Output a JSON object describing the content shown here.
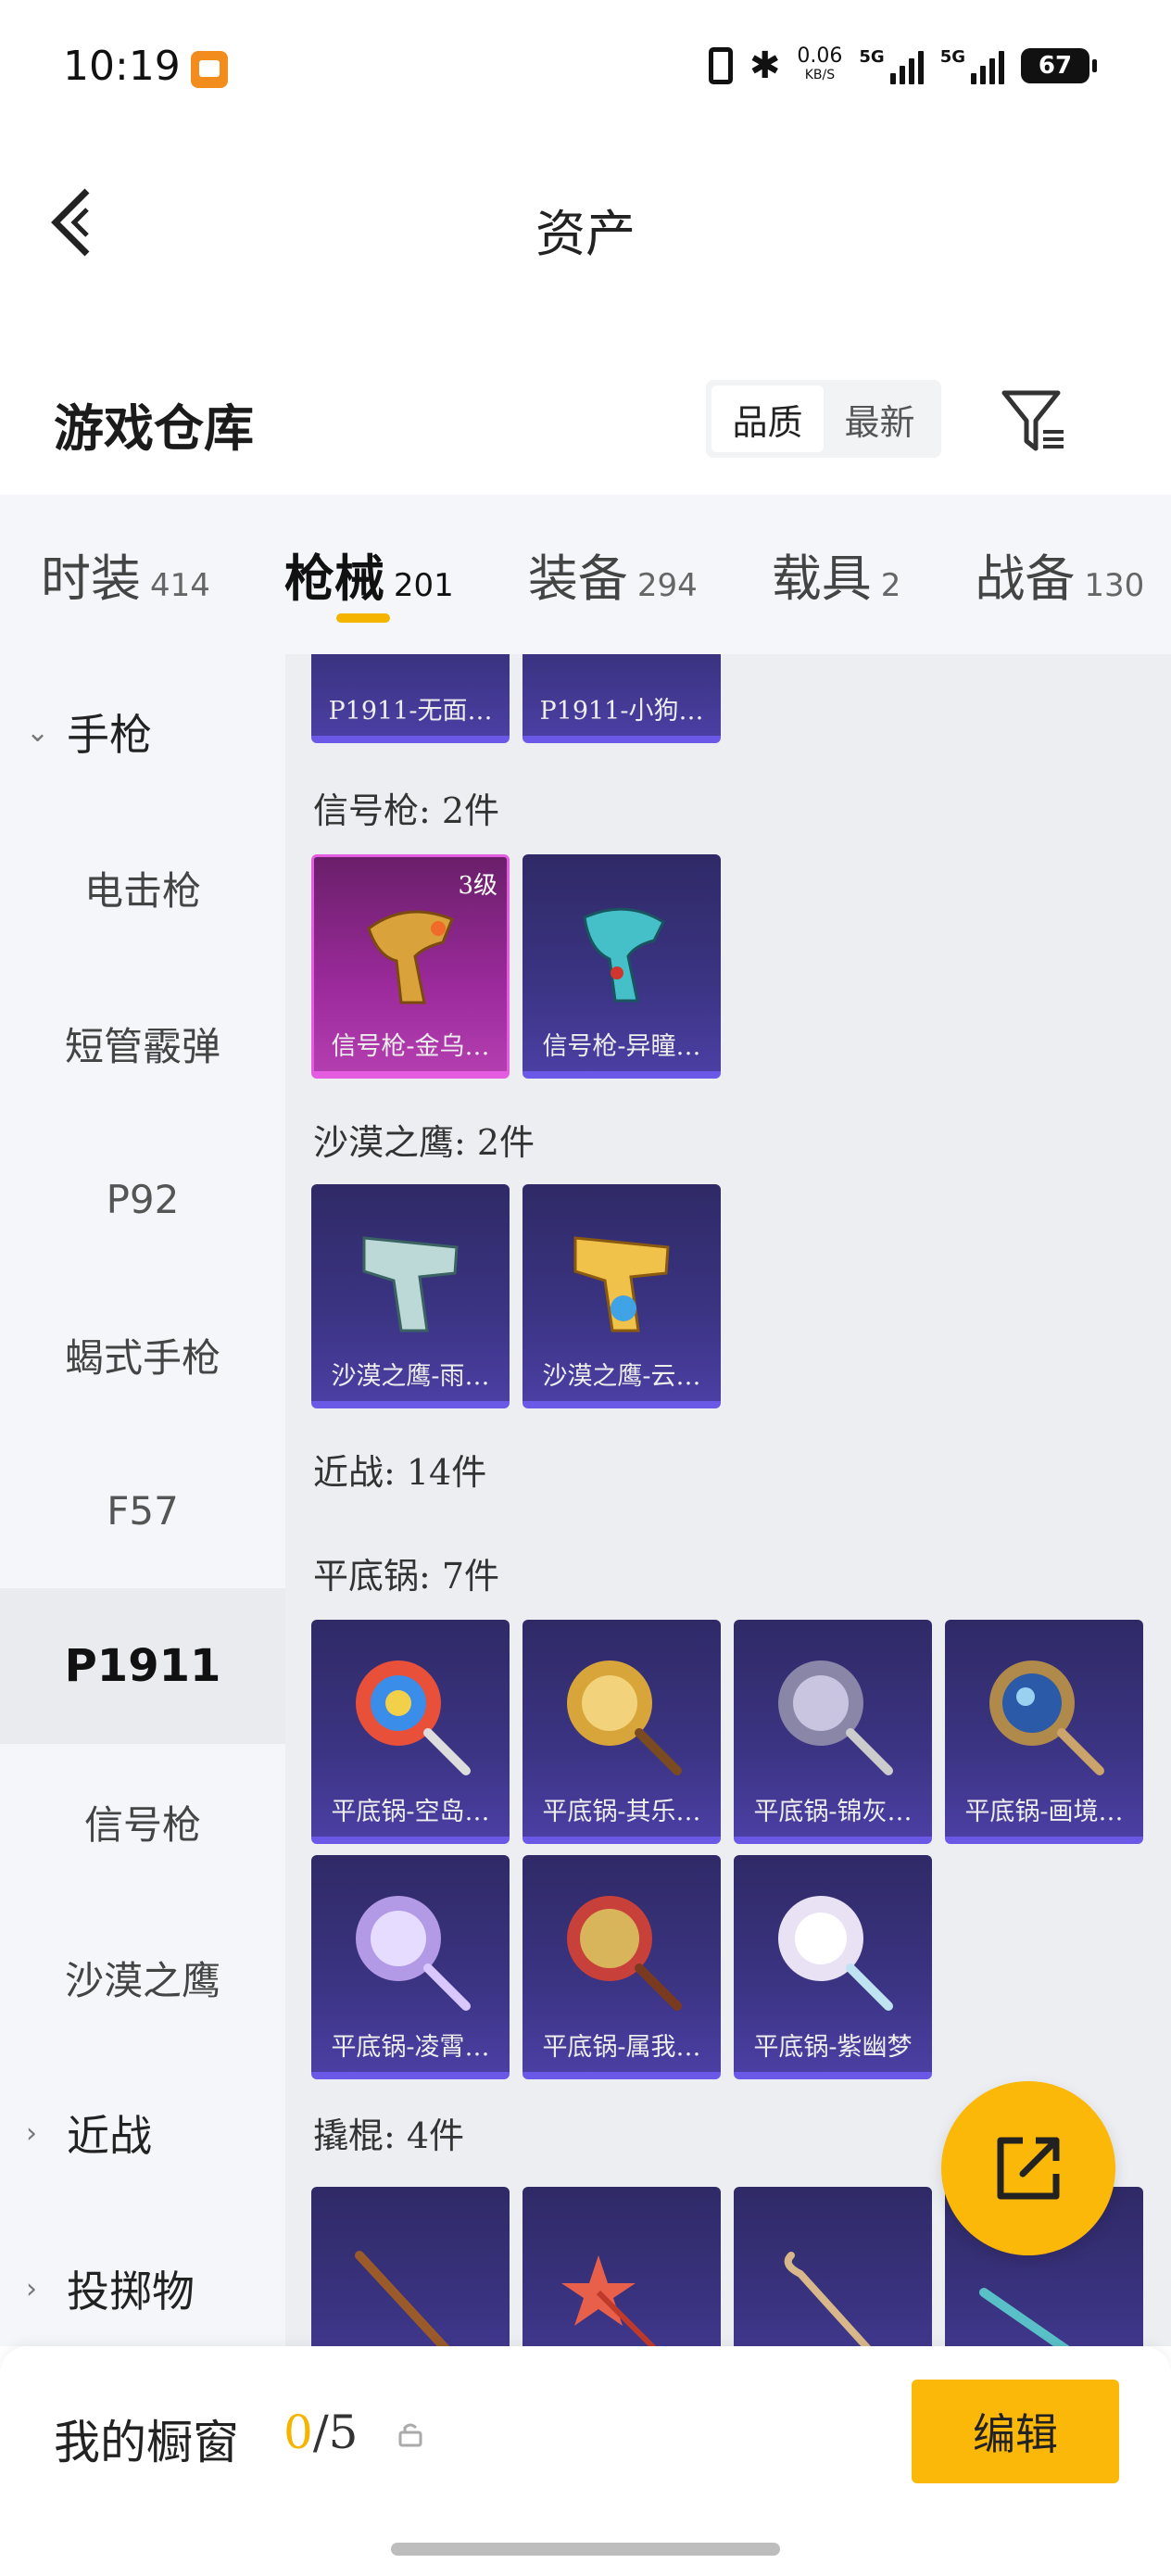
{
  "status_bar": {
    "time": "10:19",
    "speed_value": "0.06",
    "speed_unit": "KB/S",
    "signal1_label": "5G",
    "signal2_label": "5G",
    "battery": "67"
  },
  "header": {
    "title": "资产"
  },
  "section": {
    "title": "游戏仓库",
    "sort_options": [
      "品质",
      "最新"
    ],
    "active_sort": "品质"
  },
  "category_tabs": [
    {
      "label": "时装",
      "count": "414"
    },
    {
      "label": "枪械",
      "count": "201",
      "active": true
    },
    {
      "label": "装备",
      "count": "294"
    },
    {
      "label": "载具",
      "count": "2"
    },
    {
      "label": "战备",
      "count": "130"
    }
  ],
  "subnav": {
    "groups": [
      {
        "label": "手枪",
        "chevron": "⌄"
      },
      {
        "label": "近战",
        "chevron": "›"
      },
      {
        "label": "投掷物",
        "chevron": "›"
      }
    ],
    "items": [
      "电击枪",
      "短管霰弹",
      "P92",
      "蝎式手枪",
      "F57",
      "P1911",
      "信号枪",
      "沙漠之鹰"
    ],
    "selected": "P1911"
  },
  "content": {
    "top_cards": [
      "P1911-无面…",
      "P1911-小狗…"
    ],
    "signal_gun_label": "信号枪: 2件",
    "signal_gun_cards": [
      {
        "name": "信号枪-金乌…",
        "badge": "3级",
        "rarity": "gold"
      },
      {
        "name": "信号枪-异瞳…"
      }
    ],
    "deagle_label": "沙漠之鹰: 2件",
    "deagle_cards": [
      "沙漠之鹰-雨…",
      "沙漠之鹰-云…"
    ],
    "melee_label": "近战: 14件",
    "pan_label": "平底锅: 7件",
    "pan_cards": [
      "平底锅-空岛…",
      "平底锅-其乐…",
      "平底锅-锦灰…",
      "平底锅-画境…",
      "平底锅-凌霄…",
      "平底锅-属我…",
      "平底锅-紫幽梦"
    ],
    "crowbar_label": "撬棍: 4件"
  },
  "bottom_bar": {
    "showcase_label": "我的橱窗",
    "showcase_current": "0",
    "showcase_total": "/5",
    "edit_label": "编辑"
  },
  "colors": {
    "accent": "#fbb808",
    "card_purple": "#3b3483",
    "card_gold": "#9b2a9b",
    "tab_underline": "#f4b400"
  }
}
